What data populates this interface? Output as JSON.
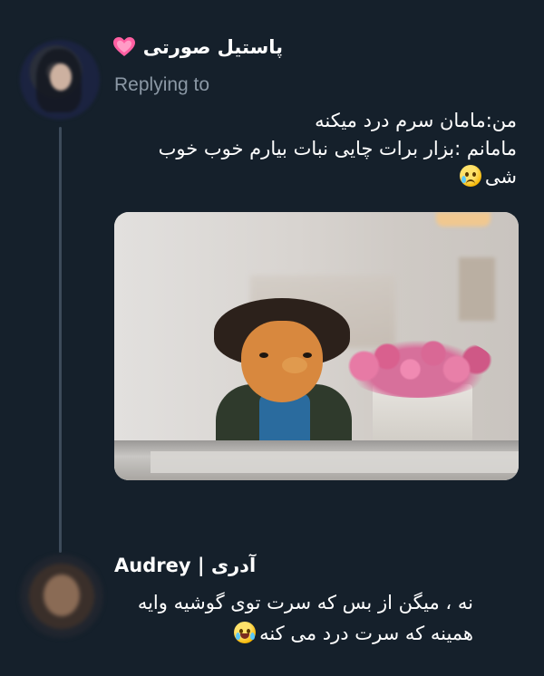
{
  "tweet": {
    "author_name": "پاستیل صورتی",
    "author_emoji": "heart-icon",
    "replying_label": "Replying to",
    "text_lines": [
      "من:مامان سرم درد میکنه",
      "مامانم :بزار برات چایی نبات بیارم خوب خوب",
      "شی"
    ],
    "text_emoji": "crying-face-icon",
    "media": "puppet-scene-image"
  },
  "reply": {
    "author_name": "Audrey | آدری",
    "text_lines": [
      "نه ، میگن از بس که سرت توی گوشیه وایه",
      "همینه که سرت درد می کنه"
    ],
    "text_emoji": "laughing-crying-face-icon"
  },
  "colors": {
    "background": "#15202b",
    "secondary_text": "#8b98a5",
    "thread_line": "#3d4b5a",
    "heart": "#ff5fa2"
  }
}
